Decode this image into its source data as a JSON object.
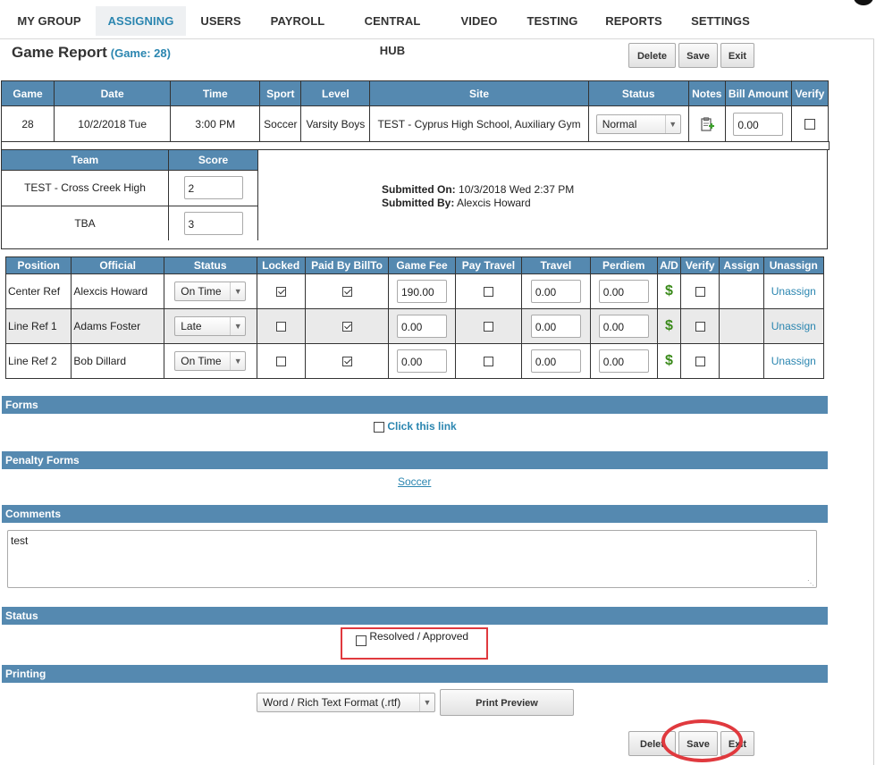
{
  "nav": {
    "items": [
      {
        "label": "MY GROUP"
      },
      {
        "label": "ASSIGNING"
      },
      {
        "label": "USERS"
      },
      {
        "label": "PAYROLL"
      },
      {
        "label": "CENTRAL HUB"
      },
      {
        "label": "VIDEO"
      },
      {
        "label": "TESTING"
      },
      {
        "label": "REPORTS"
      },
      {
        "label": "SETTINGS"
      }
    ],
    "active": "ASSIGNING"
  },
  "header": {
    "title": "Game Report",
    "game_label": "(Game: 28)",
    "delete_label": "Delete",
    "save_label": "Save",
    "exit_label": "Exit"
  },
  "game_table": {
    "columns": [
      "Game",
      "Date",
      "Time",
      "Sport",
      "Level",
      "Site",
      "Status",
      "Notes",
      "Bill Amount",
      "Verify"
    ],
    "row": {
      "game": "28",
      "date": "10/2/2018 Tue",
      "time": "3:00 PM",
      "sport": "Soccer",
      "level": "Varsity Boys",
      "site": "TEST - Cyprus High School, Auxiliary Gym",
      "status": "Normal",
      "notes_icon": "clipboard-add-icon",
      "bill_amount": "0.00",
      "verify": false
    }
  },
  "score_table": {
    "columns": [
      "Team",
      "Score"
    ],
    "rows": [
      {
        "team": "TEST - Cross Creek High",
        "score": "2"
      },
      {
        "team": "TBA",
        "score": "3"
      }
    ],
    "submitted_on_label": "Submitted On:",
    "submitted_on": "10/3/2018 Wed 2:37 PM",
    "submitted_by_label": "Submitted By:",
    "submitted_by": "Alexcis Howard"
  },
  "officials_table": {
    "columns": [
      "Position",
      "Official",
      "Status",
      "Locked",
      "Paid By BillTo",
      "Game Fee",
      "Pay Travel",
      "Travel",
      "Perdiem",
      "A/D",
      "Verify",
      "Assign",
      "Unassign"
    ],
    "rows": [
      {
        "position": "Center Ref",
        "official": "Alexcis Howard",
        "status": "On Time",
        "locked": true,
        "paid": true,
        "fee": "190.00",
        "pay_travel": false,
        "travel": "0.00",
        "perdiem": "0.00",
        "verify": false,
        "unassign": "Unassign"
      },
      {
        "position": "Line Ref 1",
        "official": "Adams Foster",
        "status": "Late",
        "locked": false,
        "paid": true,
        "fee": "0.00",
        "pay_travel": false,
        "travel": "0.00",
        "perdiem": "0.00",
        "verify": false,
        "unassign": "Unassign"
      },
      {
        "position": "Line Ref 2",
        "official": "Bob Dillard",
        "status": "On Time",
        "locked": false,
        "paid": true,
        "fee": "0.00",
        "pay_travel": false,
        "travel": "0.00",
        "perdiem": "0.00",
        "verify": false,
        "unassign": "Unassign"
      }
    ],
    "ad_icon": "dollar-icon"
  },
  "sections": {
    "forms": "Forms",
    "forms_link": "Click this link",
    "penalty_forms": "Penalty Forms",
    "penalty_link": "Soccer",
    "comments": "Comments",
    "comments_value": "test",
    "status": "Status",
    "resolved_label": "Resolved / Approved",
    "printing": "Printing",
    "print_format": "Word / Rich Text Format (.rtf)",
    "print_preview": "Print Preview"
  },
  "footer": {
    "delete_label": "Delet",
    "save_label": "Save",
    "exit_label": "Exit"
  },
  "colors": {
    "header_blue": "#5589b0",
    "link_blue": "#2b86b0",
    "highlight_red": "#e0393e"
  }
}
